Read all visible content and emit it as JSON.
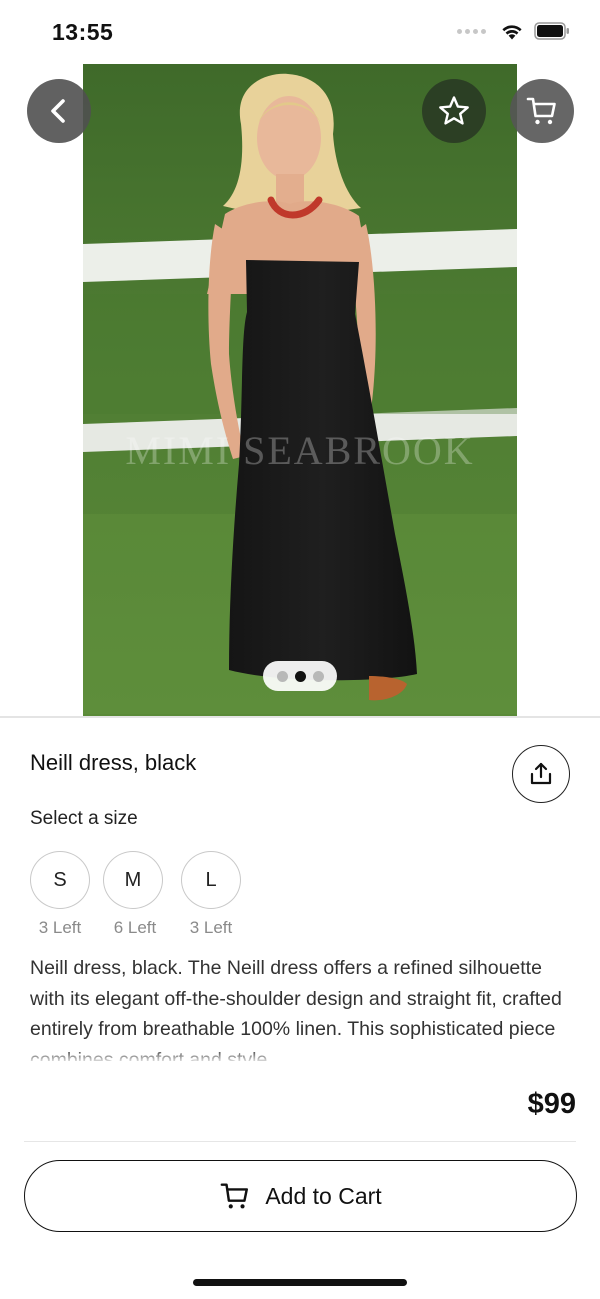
{
  "status_bar": {
    "time": "13:55",
    "icons": [
      "signal-icon",
      "wifi-icon",
      "battery-icon"
    ]
  },
  "hero": {
    "watermark": "MIMI SEABROOK",
    "pager": {
      "count": 3,
      "active_index": 1
    },
    "buttons": [
      "back-icon",
      "star-icon",
      "cart-icon"
    ]
  },
  "product": {
    "title": "Neill dress, black",
    "share_icon": "share-icon",
    "size_label": "Select a size",
    "sizes": [
      {
        "label": "S",
        "stock": "3 Left"
      },
      {
        "label": "M",
        "stock": "6 Left"
      },
      {
        "label": "L",
        "stock": "3 Left"
      }
    ],
    "description": "Neill dress, black. The Neill dress offers a refined silhouette with its elegant off-the-shoulder design and straight fit, crafted entirely from breathable 100% linen. This sophisticated piece combines comfort and style"
  },
  "checkout": {
    "price": "$99",
    "add_to_cart_label": "Add to Cart",
    "add_to_cart_icon": "cart-icon"
  },
  "colors": {
    "accent": "#111111",
    "muted_text": "#8a8a8a",
    "chip_border": "#c9c9c9"
  }
}
